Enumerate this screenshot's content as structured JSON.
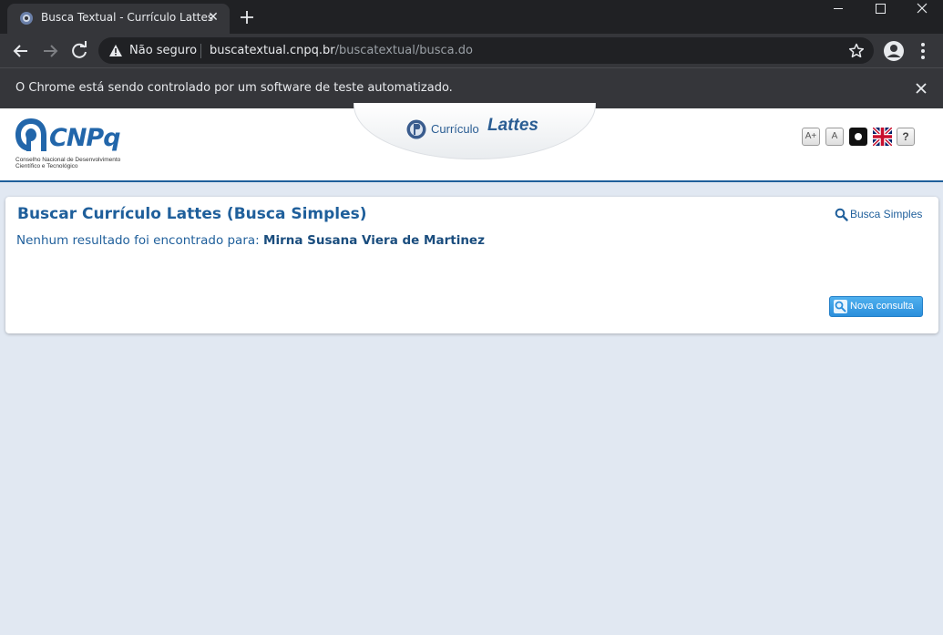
{
  "browser": {
    "tab_title": "Busca Textual - Currículo Lattes",
    "security_label": "Não seguro",
    "url_host": "buscatextual.cnpq.br",
    "url_path": "/buscatextual/busca.do",
    "infobar_text": "O Chrome está sendo controlado por um software de teste automatizado."
  },
  "header": {
    "cnpq_name": "CNPq",
    "cnpq_subtitle_line1": "Conselho Nacional de Desenvolvimento",
    "cnpq_subtitle_line2": "Científico e Tecnológico",
    "lattes_prefix": "Currículo",
    "lattes_word": "Lattes",
    "accessibility": {
      "increase_font": "A+",
      "normal_font": "A",
      "help": "?"
    }
  },
  "main": {
    "title": "Buscar Currículo Lattes (Busca Simples)",
    "busca_simples_link": "Busca Simples",
    "result_prefix": "Nenhum resultado foi encontrado para:",
    "query_name": "Mirna Susana Viera de Martinez",
    "new_query_button": "Nova consulta"
  },
  "colors": {
    "brand_blue": "#1f5f9b",
    "button_blue": "#2b8fdc",
    "page_background": "#e1e8f2",
    "chrome_dark": "#202124"
  }
}
